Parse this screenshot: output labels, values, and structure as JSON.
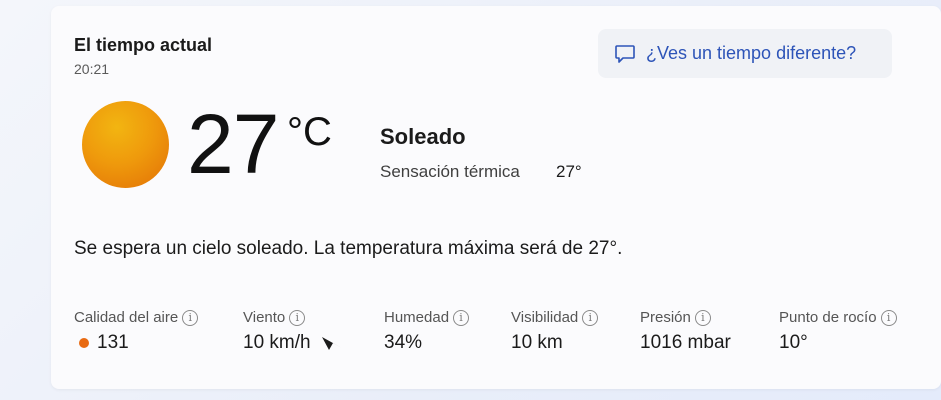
{
  "header": {
    "title": "El tiempo actual",
    "time": "20:21"
  },
  "feedback": {
    "label": "¿Ves un tiempo diferente?",
    "icon": "chat-bubble-icon"
  },
  "current": {
    "icon": "sun-icon",
    "temperature": "27",
    "unit": "°C",
    "condition": "Soleado",
    "feels_like_label": "Sensación térmica",
    "feels_like_value": "27°"
  },
  "summary": "Se espera un cielo soleado. La temperatura máxima será de 27°.",
  "metrics": [
    {
      "label": "Calidad del aire",
      "value": "131",
      "indicator_color": "#e86a12"
    },
    {
      "label": "Viento",
      "value": "10 km/h",
      "icon": "wind-direction-arrow-icon"
    },
    {
      "label": "Humedad",
      "value": "34%"
    },
    {
      "label": "Visibilidad",
      "value": "10 km"
    },
    {
      "label": "Presión",
      "value": "1016 mbar"
    },
    {
      "label": "Punto de rocío",
      "value": "10°"
    }
  ],
  "colors": {
    "accent": "#2d54b8",
    "sun": "#ef9a0c",
    "aqi": "#e86a12"
  }
}
